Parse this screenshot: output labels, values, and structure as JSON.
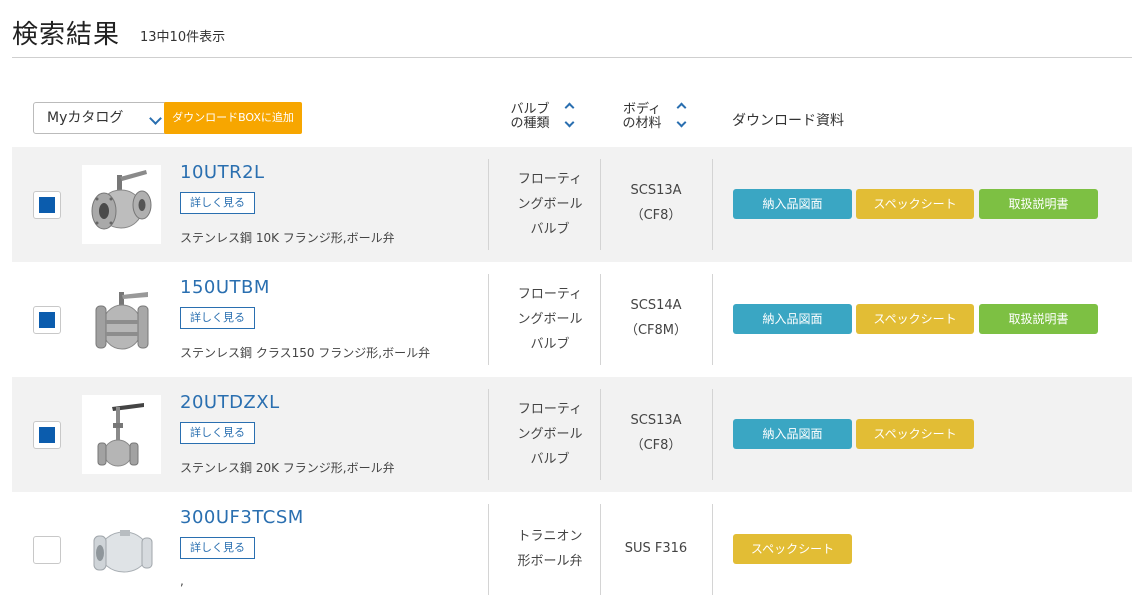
{
  "header": {
    "title": "検索結果",
    "count": "13中10件表示"
  },
  "toolbar": {
    "catalog_label": "Myカタログ",
    "add_box_label": "ダウンロードBOXに追加",
    "col_valve_type": [
      "バルブ",
      "の種類"
    ],
    "col_body_material": [
      "ボディ",
      "の材料"
    ],
    "col_download": "ダウンロード資料"
  },
  "colors": {
    "link": "#2a6fb0",
    "add_box": "#f7a600",
    "delivery": "#3aa6c3",
    "spec": "#e2bd35",
    "manual": "#7dc043",
    "check": "#0b5cad"
  },
  "products": [
    {
      "name": "10UTR2L",
      "detail_label": "詳しく見る",
      "description": "ステンレス鋼 10K フランジ形,ボール弁",
      "valve_type": [
        "フローティ",
        "ングボール",
        "バルブ"
      ],
      "material": [
        "SCS13A",
        "（CF8）"
      ],
      "checked": true,
      "downloads": [
        "納入品図面",
        "スペックシート",
        "取扱説明書"
      ]
    },
    {
      "name": "150UTBM",
      "detail_label": "詳しく見る",
      "description": "ステンレス鋼 クラス150 フランジ形,ボール弁",
      "valve_type": [
        "フローティ",
        "ングボール",
        "バルブ"
      ],
      "material": [
        "SCS14A",
        "（CF8M）"
      ],
      "checked": true,
      "downloads": [
        "納入品図面",
        "スペックシート",
        "取扱説明書"
      ]
    },
    {
      "name": "20UTDZXL",
      "detail_label": "詳しく見る",
      "description": "ステンレス鋼 20K フランジ形,ボール弁",
      "valve_type": [
        "フローティ",
        "ングボール",
        "バルブ"
      ],
      "material": [
        "SCS13A",
        "（CF8）"
      ],
      "checked": true,
      "downloads": [
        "納入品図面",
        "スペックシート"
      ]
    },
    {
      "name": "300UF3TCSM",
      "detail_label": "詳しく見る",
      "description": ",",
      "valve_type": [
        "トラニオン",
        "形ボール弁"
      ],
      "material": [
        "SUS F316"
      ],
      "checked": false,
      "downloads": [
        "スペックシート"
      ]
    }
  ]
}
